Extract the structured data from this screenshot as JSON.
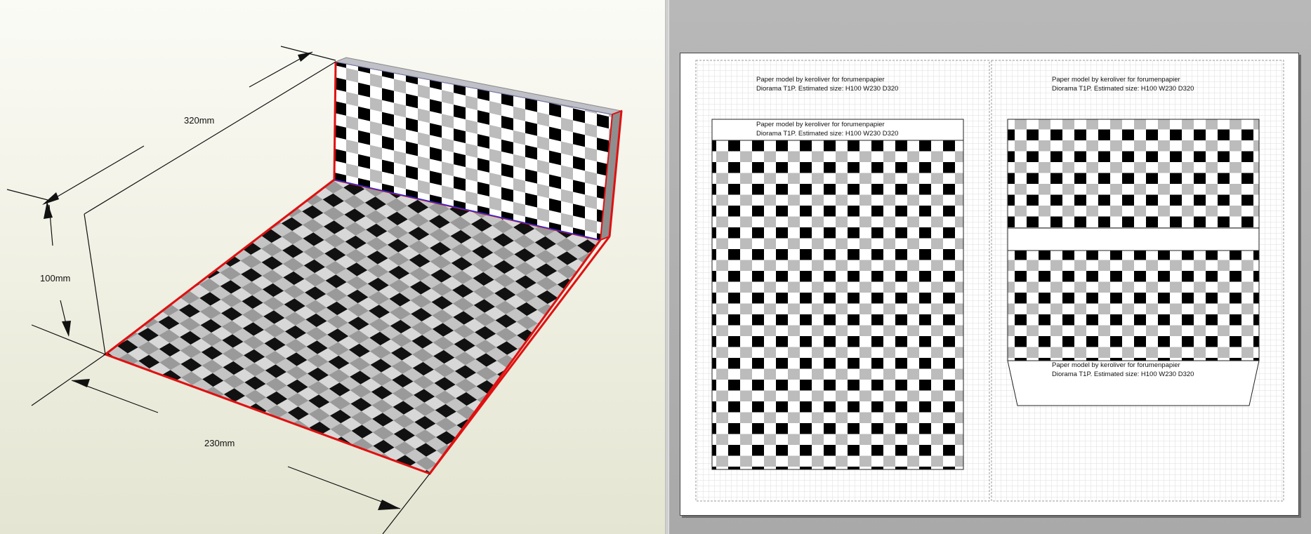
{
  "dimensions": {
    "depth_label": "320mm",
    "height_label": "100mm",
    "width_label": "230mm"
  },
  "page_notes": [
    {
      "line1": "Paper model by keroliver for forumenpapier",
      "line2": "Diorama T1P. Estimated size: H100 W230 D320"
    },
    {
      "line1": "Paper model by keroliver for forumenpapier",
      "line2": "Diorama T1P. Estimated size: H100 W230 D320"
    },
    {
      "line1": "Paper model by keroliver for forumenpapier",
      "line2": "Diorama T1P. Estimated size: H100 W230 D320"
    },
    {
      "line1": "Paper model by keroliver for forumenpapier",
      "line2": "Diorama T1P. Estimated size: H100 W230 D320"
    }
  ],
  "colors": {
    "edge_red": "#e01010",
    "fold_blue": "#2a2ae0",
    "check_dark": "#000000",
    "check_light": "#ffffff",
    "check_grey": "#bdbdbd"
  }
}
